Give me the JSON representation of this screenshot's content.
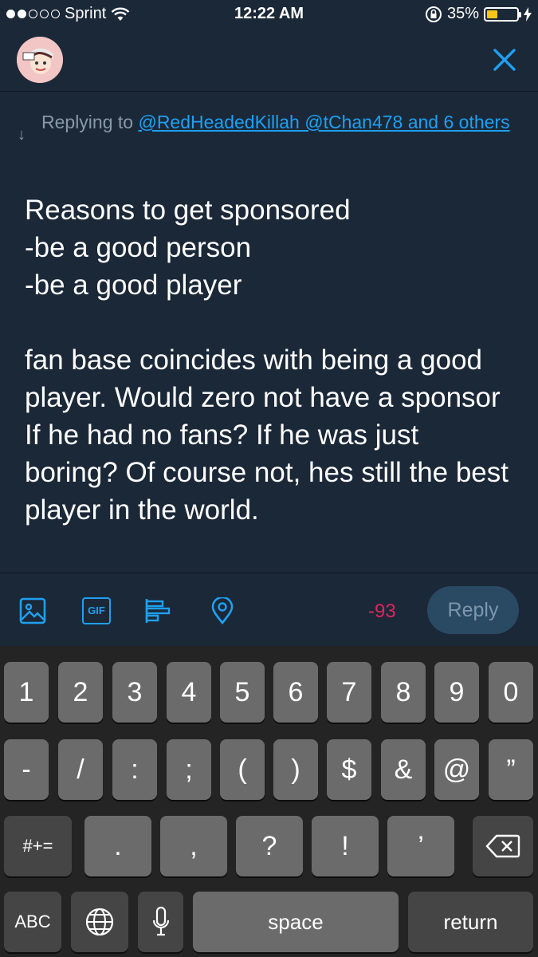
{
  "status_bar": {
    "carrier": "Sprint",
    "time": "12:22 AM",
    "battery_percent": "35%",
    "battery_level": 0.35,
    "battery_color": "#f5c518"
  },
  "header": {
    "avatar_icon": "avatar",
    "close_icon": "close-icon"
  },
  "reply_context": {
    "prefix": "Replying to",
    "link_text": "@RedHeadedKillah @tChan478 and 6 others"
  },
  "tweet": {
    "text": "Reasons to get sponsored\n-be a good person\n-be a good player\n\nfan base coincides with being a good player. Would zero not have a sponsor If he had no fans? If he was just boring? Of course not, hes still the best player in the world."
  },
  "toolbar": {
    "icons": [
      "image-icon",
      "gif-icon",
      "poll-icon",
      "location-icon"
    ],
    "gif_label": "GIF",
    "char_counter": "-93",
    "counter_color": "#e0245e",
    "reply_label": "Reply"
  },
  "keyboard": {
    "row1": [
      "1",
      "2",
      "3",
      "4",
      "5",
      "6",
      "7",
      "8",
      "9",
      "0"
    ],
    "row2": [
      "-",
      "/",
      ":",
      ";",
      "(",
      ")",
      "$",
      "&",
      "@",
      "”"
    ],
    "row3": [
      "#+=",
      ".",
      ",",
      "?",
      "!",
      "’"
    ],
    "row4": [
      "ABC",
      "space",
      "return"
    ]
  }
}
